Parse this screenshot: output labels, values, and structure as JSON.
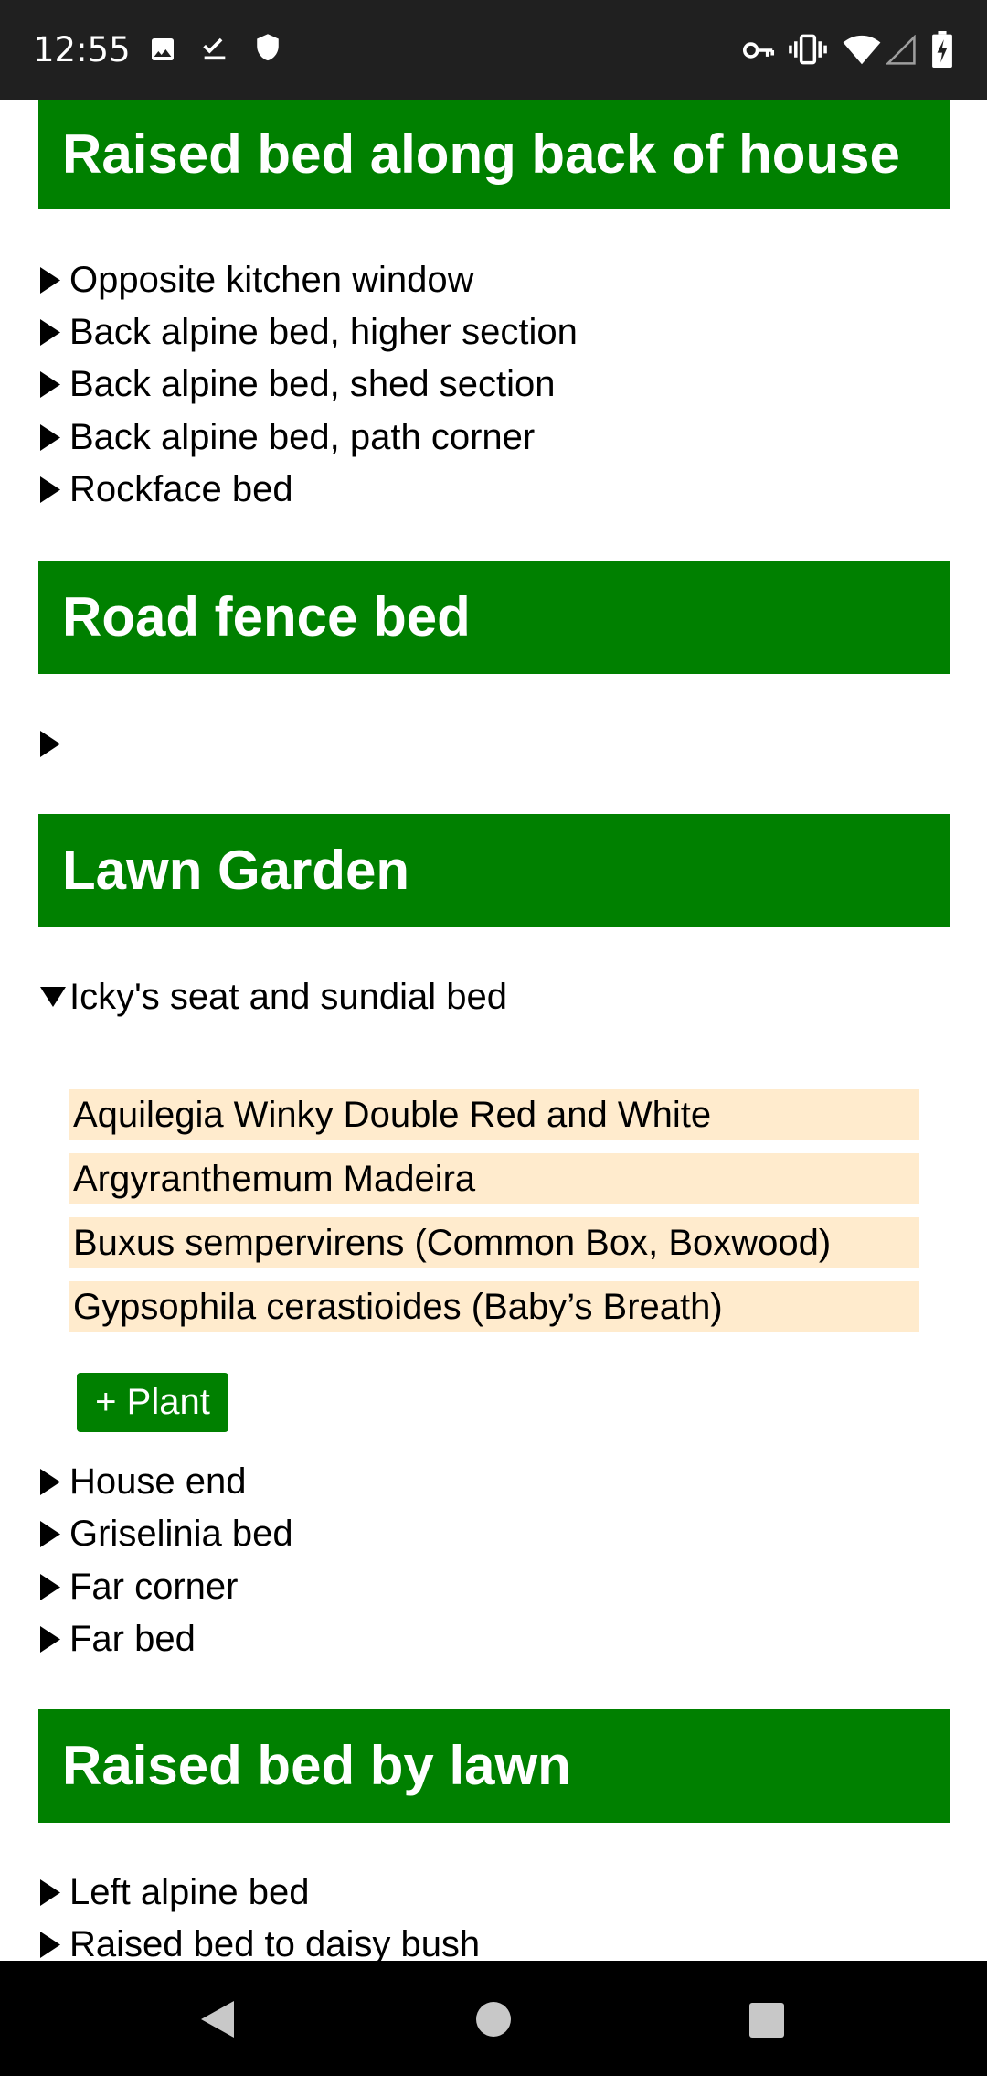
{
  "status_bar": {
    "time": "12:55",
    "left_icons": [
      "image-icon",
      "check-download-icon",
      "shield-icon"
    ],
    "right_icons": [
      "vpn-key-icon",
      "vibrate-icon",
      "wifi-icon",
      "cell-signal-icon",
      "battery-charging-icon"
    ]
  },
  "sections": [
    {
      "title": "Raised bed along back of house",
      "beds": [
        {
          "label": "Opposite kitchen window",
          "expanded": false
        },
        {
          "label": "Back alpine bed, higher section",
          "expanded": false
        },
        {
          "label": "Back alpine bed, shed section",
          "expanded": false
        },
        {
          "label": "Back alpine bed, path corner",
          "expanded": false
        },
        {
          "label": "Rockface bed",
          "expanded": false
        }
      ]
    },
    {
      "title": "Road fence bed",
      "beds": [
        {
          "label": "",
          "expanded": false
        }
      ]
    },
    {
      "title": "Lawn Garden",
      "beds": [
        {
          "label": "Icky's seat and sundial bed",
          "expanded": true,
          "plants": [
            "Aquilegia Winky Double Red and White",
            "Argyranthemum Madeira",
            "Buxus sempervirens (Common Box, Boxwood)",
            "Gypsophila cerastioides (Baby’s Breath)"
          ],
          "add_button_label": "+ Plant"
        },
        {
          "label": "House end",
          "expanded": false
        },
        {
          "label": "Griselinia bed",
          "expanded": false
        },
        {
          "label": "Far corner",
          "expanded": false
        },
        {
          "label": "Far bed",
          "expanded": false
        }
      ]
    },
    {
      "title": "Raised bed by lawn",
      "beds": [
        {
          "label": "Left alpine bed",
          "expanded": false
        },
        {
          "label": "Raised bed to daisy bush",
          "expanded": false
        }
      ]
    }
  ],
  "nav_bar": {
    "icons": [
      "back-icon",
      "home-icon",
      "recents-icon"
    ]
  },
  "colors": {
    "header_green": "#008000",
    "plant_background": "#ffebcd",
    "status_bar": "#202020",
    "nav_bar": "#000000"
  }
}
